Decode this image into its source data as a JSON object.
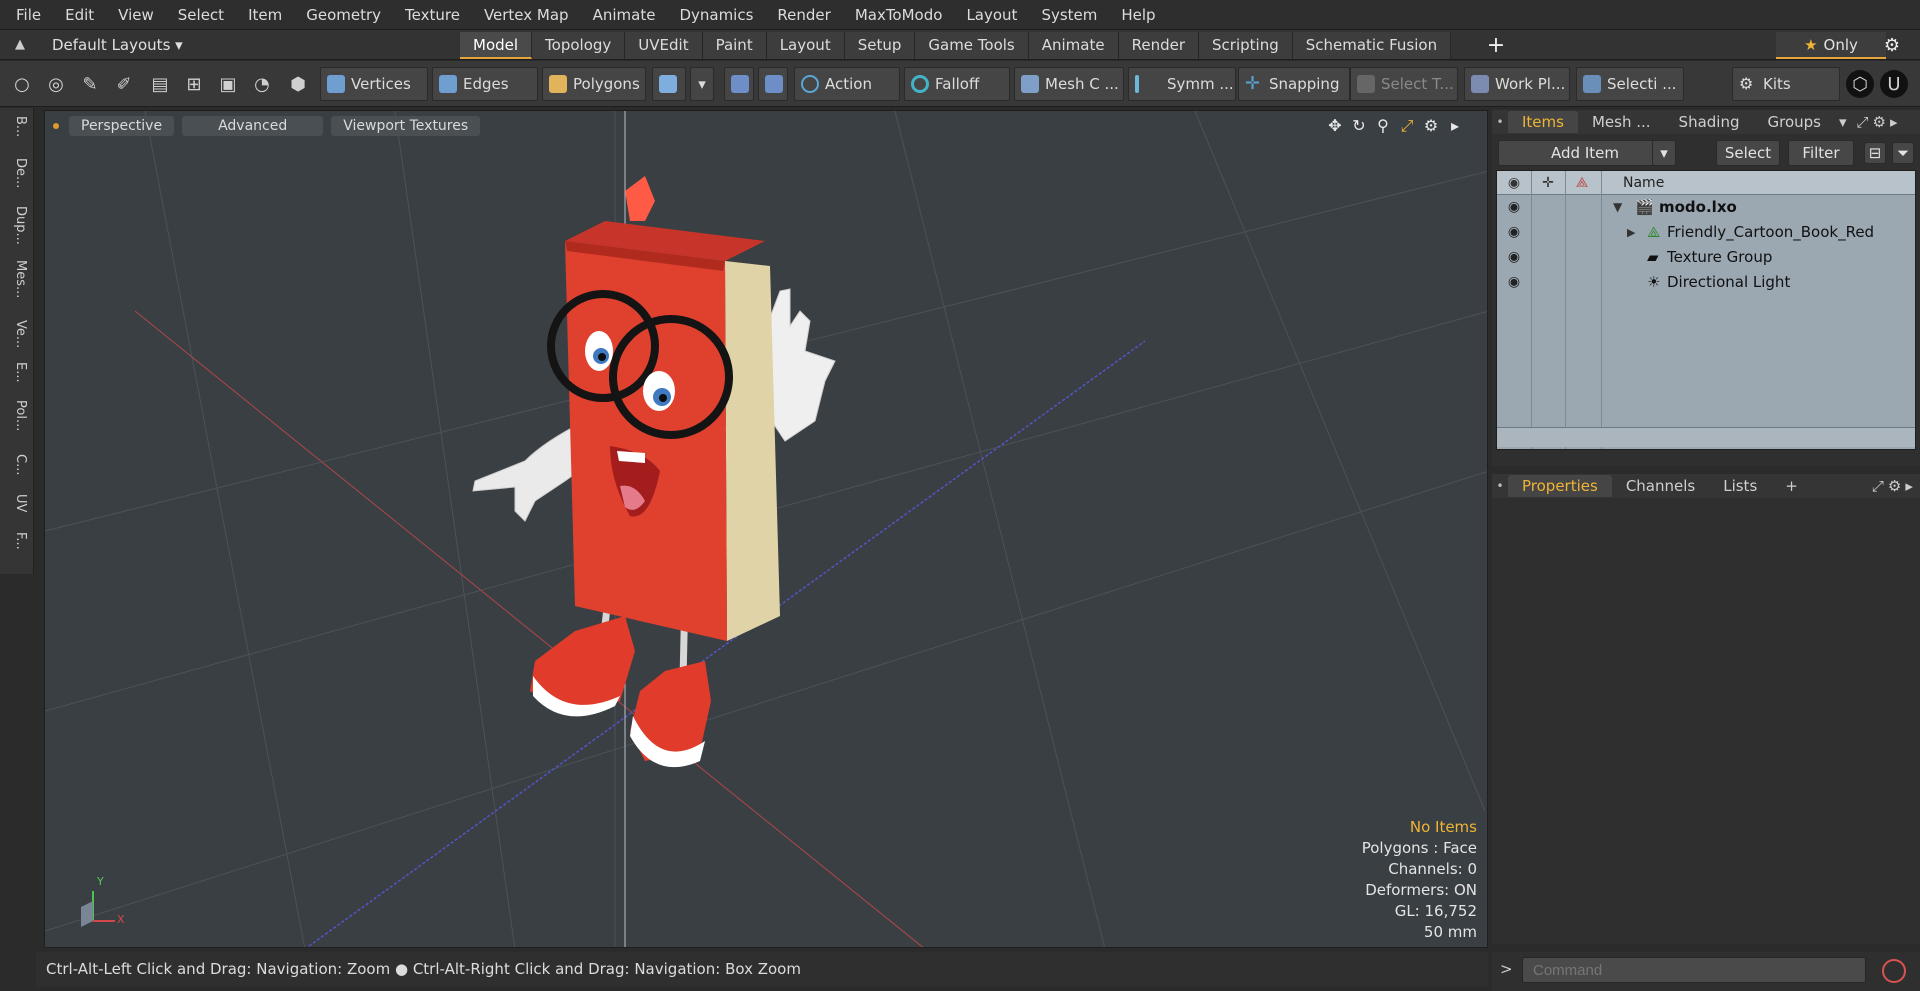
{
  "menu": [
    "File",
    "Edit",
    "View",
    "Select",
    "Item",
    "Geometry",
    "Texture",
    "Vertex Map",
    "Animate",
    "Dynamics",
    "Render",
    "MaxToModo",
    "Layout",
    "System",
    "Help"
  ],
  "layout_bar": {
    "layout_select": "Default Layouts ▾",
    "tabs": [
      "Model",
      "Topology",
      "UVEdit",
      "Paint",
      "Layout",
      "Setup",
      "Game Tools",
      "Animate",
      "Render",
      "Scripting",
      "Schematic Fusion"
    ],
    "active_tab": "Model",
    "add_tab": "+",
    "only_label": "Only"
  },
  "toolbar": {
    "vertices": "Vertices",
    "edges": "Edges",
    "polygons": "Polygons",
    "action": "Action",
    "falloff": "Falloff",
    "mesh_c": "Mesh C ...",
    "symm": "Symm ...",
    "snapping": "Snapping",
    "select_t": "Select T...",
    "work_pl": "Work Pl...",
    "selecti": "Selecti ...",
    "kits": "Kits"
  },
  "left_strip": [
    "B...",
    "De...",
    "Dup...",
    "Mes...",
    "Ve...",
    "E...",
    "Pol...",
    "C...",
    "UV",
    "F..."
  ],
  "viewport": {
    "perspective": "Perspective",
    "advanced": "Advanced",
    "viewport_textures": "Viewport Textures",
    "info": {
      "no_items": "No Items",
      "polygons": "Polygons : Face",
      "channels": "Channels: 0",
      "deformers": "Deformers: ON",
      "gl": "GL: 16,752",
      "size": "50 mm"
    },
    "axis_y": "Y",
    "axis_x": "X"
  },
  "status_bar": "Ctrl-Alt-Left Click and Drag: Navigation: Zoom ● Ctrl-Alt-Right Click and Drag: Navigation: Box Zoom",
  "items_panel": {
    "tabs": [
      "Items",
      "Mesh ...",
      "Shading",
      "Groups"
    ],
    "active_tab": "Items",
    "add_item": "Add Item",
    "select": "Select",
    "filter": "Filter",
    "name_header": "Name",
    "rows": [
      {
        "label": "modo.lxo"
      },
      {
        "label": "Friendly_Cartoon_Book_Red"
      },
      {
        "label": "Texture Group"
      },
      {
        "label": "Directional Light"
      }
    ]
  },
  "properties_panel": {
    "tabs": [
      "Properties",
      "Channels",
      "Lists"
    ],
    "active_tab": "Properties",
    "add_tab": "+"
  },
  "command": {
    "placeholder": "Command",
    "prompt": ">"
  },
  "colors": {
    "accent": "#f0b436",
    "book_red": "#e0412f",
    "list_bg": "#9ba8b2",
    "viewport_bg": "#3a3f43"
  }
}
